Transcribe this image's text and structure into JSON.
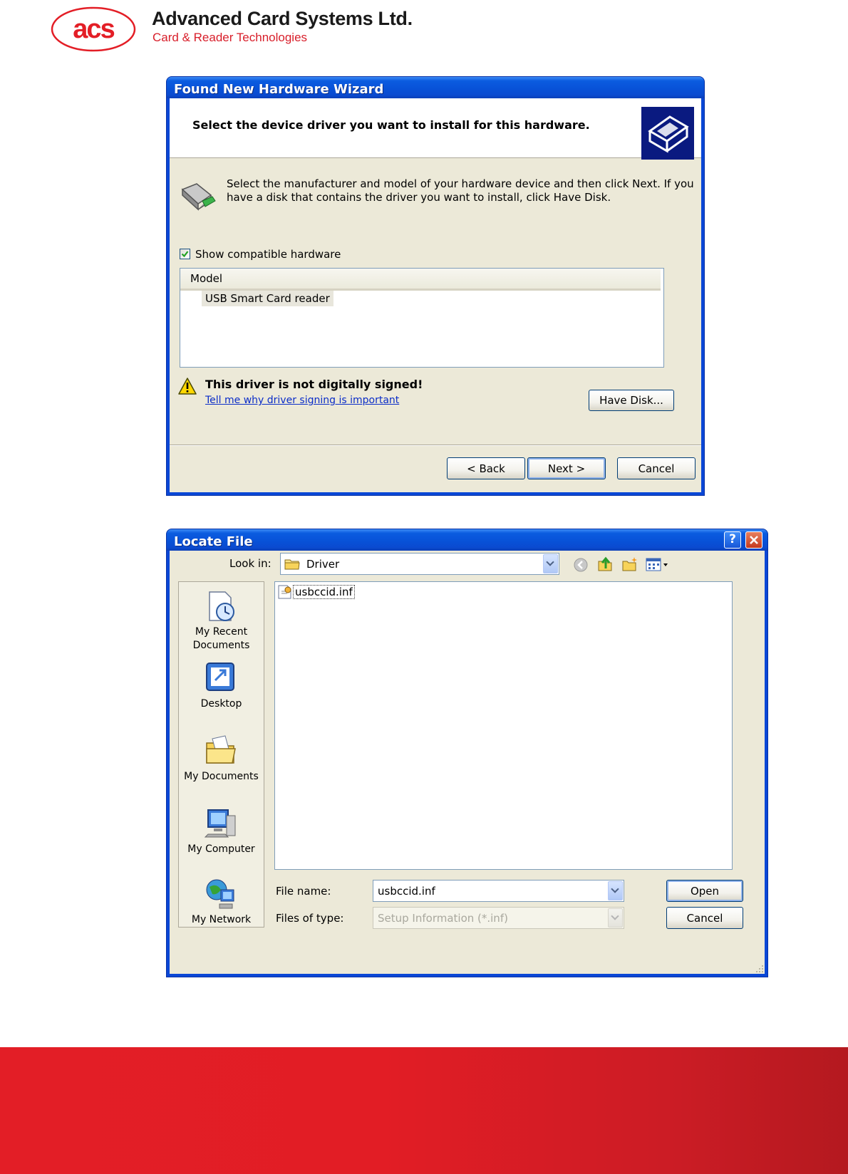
{
  "header": {
    "company": "Advanced Card Systems Ltd.",
    "tagline": "Card & Reader Technologies",
    "logo_text": "acs",
    "brand_color": "#e31e26"
  },
  "wizard": {
    "title": "Found New Hardware Wizard",
    "heading": "Select the device driver you want to install for this hardware.",
    "instruction_line1": "Select the manufacturer and model of your hardware device and then click Next. If you",
    "instruction_line2": "have a disk that contains the driver you want to install, click Have Disk.",
    "show_compatible_label": "Show compatible hardware",
    "show_compatible_checked": true,
    "model_header": "Model",
    "models": [
      "USB Smart Card reader"
    ],
    "warning_text": "This driver is not digitally signed!",
    "signing_link": "Tell me why driver signing is important",
    "have_disk_label": "Have Disk...",
    "back_label": "< Back",
    "next_label": "Next >",
    "cancel_label": "Cancel",
    "icons": [
      "hardware-icon",
      "card-reader-icon",
      "warning-icon",
      "checkbox-check-icon"
    ]
  },
  "locate": {
    "title": "Locate File",
    "help_label": "?",
    "look_in_label": "Look in:",
    "look_in_value": "Driver",
    "places": [
      {
        "label_line1": "My Recent",
        "label_line2": "Documents",
        "icon": "recent-documents-icon"
      },
      {
        "label_line1": "Desktop",
        "label_line2": "",
        "icon": "desktop-icon"
      },
      {
        "label_line1": "My Documents",
        "label_line2": "",
        "icon": "my-documents-icon"
      },
      {
        "label_line1": "My Computer",
        "label_line2": "",
        "icon": "my-computer-icon"
      },
      {
        "label_line1": "My Network",
        "label_line2": "",
        "icon": "my-network-icon"
      }
    ],
    "files": [
      "usbccid.inf"
    ],
    "file_name_label": "File name:",
    "file_name_value": "usbccid.inf",
    "file_type_label": "Files of type:",
    "file_type_value": "Setup Information (*.inf)",
    "open_label": "Open",
    "cancel_label": "Cancel",
    "icons": [
      "back-icon",
      "up-folder-icon",
      "new-folder-icon",
      "views-menu-icon",
      "folder-icon",
      "inf-file-icon",
      "close-icon",
      "help-icon"
    ]
  }
}
